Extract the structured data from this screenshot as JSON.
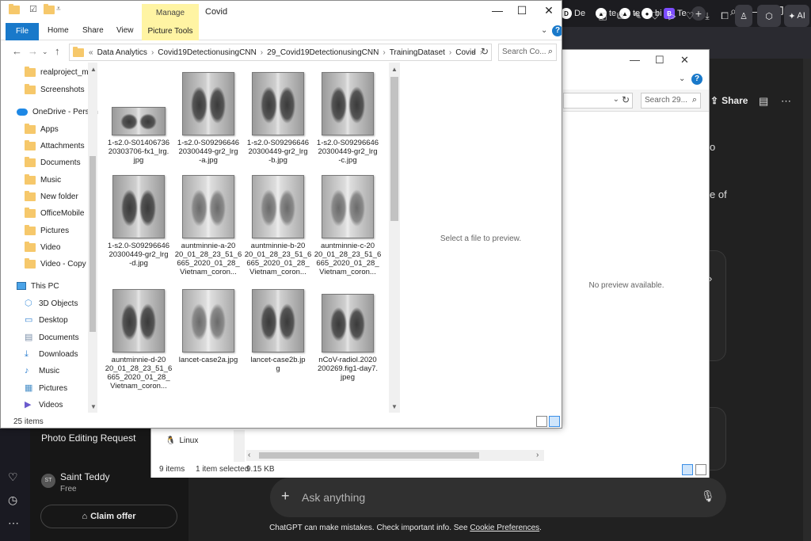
{
  "browser": {
    "tabs": [
      {
        "icon": "D",
        "label": "De"
      },
      {
        "icon": "▲",
        "label": "te"
      },
      {
        "icon": "▲",
        "label": "te"
      },
      {
        "icon": "●",
        "label": "bi"
      },
      {
        "icon": "B",
        "label": "Te"
      }
    ],
    "ai_label": "AI"
  },
  "chat": {
    "sidebar_item": "Photo Editing Request",
    "user": {
      "initials": "ST",
      "name": "Saint Teddy",
      "plan": "Free"
    },
    "claim_offer": "Claim offer",
    "share_label": "Share",
    "fragments": [
      "o",
      "e of"
    ],
    "ask_placeholder": "Ask anything",
    "disclaimer": "ChatGPT can make mistakes. Check important info. See",
    "disclaimer_link": "Cookie Preferences",
    "disclaimer_end": "."
  },
  "explorer2": {
    "search_placeholder": "Search 29...",
    "no_preview": "No preview available.",
    "nav_item": "Linux",
    "status": {
      "items": "9 items",
      "selected": "1 item selected",
      "size": "9.15 KB"
    }
  },
  "explorer": {
    "title": "Covid",
    "manage_tab": "Manage",
    "ribbon_tabs": {
      "file": "File",
      "home": "Home",
      "share": "Share",
      "view": "View",
      "picture_tools": "Picture Tools"
    },
    "breadcrumb_prefix": "«",
    "breadcrumb": [
      "Data Analytics",
      "Covid19DetectionusingCNN",
      "29_Covid19DetectionusingCNN",
      "TrainingDataset",
      "Covid"
    ],
    "search_placeholder": "Search Co...",
    "nav_items": [
      {
        "label": "realproject_my",
        "type": "folder"
      },
      {
        "label": "Screenshots",
        "type": "folder"
      },
      {
        "label": "OneDrive - Person",
        "type": "cloud"
      },
      {
        "label": "Apps",
        "type": "folder"
      },
      {
        "label": "Attachments",
        "type": "folder"
      },
      {
        "label": "Documents",
        "type": "folder"
      },
      {
        "label": "Music",
        "type": "folder"
      },
      {
        "label": "New folder",
        "type": "folder"
      },
      {
        "label": "OfficeMobile",
        "type": "folder"
      },
      {
        "label": "Pictures",
        "type": "folder"
      },
      {
        "label": "Video",
        "type": "folder"
      },
      {
        "label": "Video - Copy",
        "type": "folder"
      },
      {
        "label": "This PC",
        "type": "pc"
      },
      {
        "label": "3D Objects",
        "type": "3d"
      },
      {
        "label": "Desktop",
        "type": "desktop"
      },
      {
        "label": "Documents",
        "type": "docs"
      },
      {
        "label": "Downloads",
        "type": "downloads"
      },
      {
        "label": "Music",
        "type": "music"
      },
      {
        "label": "Pictures",
        "type": "pictures"
      },
      {
        "label": "Videos",
        "type": "videos"
      }
    ],
    "files": [
      {
        "name": "1-s2.0-S0140673620303706-fx1_lrg.jpg",
        "lines": [
          "1-s2.0-S01406736",
          "20303706-fx1_lrg.",
          "jpg"
        ]
      },
      {
        "name": "1-s2.0-S0929664620300449-gr2_lrg-a.jpg",
        "lines": [
          "1-s2.0-S09296646",
          "20300449-gr2_lrg",
          "-a.jpg"
        ]
      },
      {
        "name": "1-s2.0-S0929664620300449-gr2_lrg-b.jpg",
        "lines": [
          "1-s2.0-S09296646",
          "20300449-gr2_lrg",
          "-b.jpg"
        ]
      },
      {
        "name": "1-s2.0-S0929664620300449-gr2_lrg-c.jpg",
        "lines": [
          "1-s2.0-S09296646",
          "20300449-gr2_lrg",
          "-c.jpg"
        ]
      },
      {
        "name": "1-s2.0-S0929664620300449-gr2_lrg-d.jpg",
        "lines": [
          "1-s2.0-S09296646",
          "20300449-gr2_lrg",
          "-d.jpg"
        ]
      },
      {
        "name": "auntminnie-a-2020_01_28_23_51_6665_2020_01_28_Vietnam_coron...",
        "lines": [
          "auntminnie-a-20",
          "20_01_28_23_51_6",
          "665_2020_01_28_",
          "Vietnam_coron..."
        ]
      },
      {
        "name": "auntminnie-b-2020_01_28_23_51_6665_2020_01_28_Vietnam_coron...",
        "lines": [
          "auntminnie-b-20",
          "20_01_28_23_51_6",
          "665_2020_01_28_",
          "Vietnam_coron..."
        ]
      },
      {
        "name": "auntminnie-c-2020_01_28_23_51_6665_2020_01_28_Vietnam_coron...",
        "lines": [
          "auntminnie-c-20",
          "20_01_28_23_51_6",
          "665_2020_01_28_",
          "Vietnam_coron..."
        ]
      },
      {
        "name": "auntminnie-d-2020_01_28_23_51_6665_2020_01_28_Vietnam_coron...",
        "lines": [
          "auntminnie-d-20",
          "20_01_28_23_51_6",
          "665_2020_01_28_",
          "Vietnam_coron..."
        ]
      },
      {
        "name": "lancet-case2a.jpg",
        "lines": [
          "lancet-case2a.jpg"
        ]
      },
      {
        "name": "lancet-case2b.jpg",
        "lines": [
          "lancet-case2b.jp",
          "g"
        ]
      },
      {
        "name": "nCoV-radiol.2020200269.fig1-day7.jpeg",
        "lines": [
          "nCoV-radiol.2020",
          "200269.fig1-day7.",
          "jpeg"
        ]
      }
    ],
    "preview_text": "Select a file to preview.",
    "status_count": "25 items"
  }
}
